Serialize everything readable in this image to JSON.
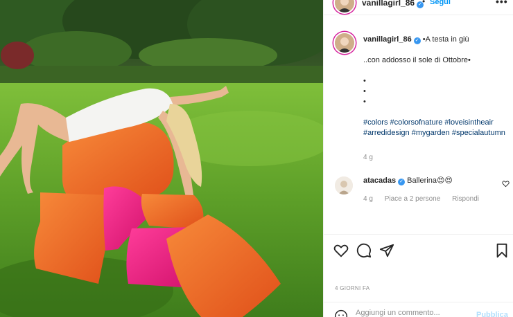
{
  "post": {
    "username": "vanillagirl_86",
    "verified_badge": "✓",
    "separator": "•",
    "follow_label": "Segui",
    "more_label": "•••"
  },
  "caption": {
    "username": "vanillagirl_86",
    "line1": "•A testa in giù",
    "line2": "..con addosso il sole di Ottobre•",
    "dots": [
      "•",
      "•",
      "•"
    ],
    "hashtags": [
      "#colors",
      "#colorsofnature",
      "#loveisintheair",
      "#arredidesign",
      "#mygarden",
      "#specialautumn"
    ],
    "time": "4 g"
  },
  "comment": {
    "username": "atacadas",
    "text": "Ballerina😍😍",
    "time": "4 g",
    "likes": "Piace a 2 persone",
    "reply": "Rispondi"
  },
  "actions": {
    "icons": [
      "heart-icon",
      "comment-icon",
      "share-icon",
      "bookmark-icon"
    ],
    "date": "4 GIORNI FA"
  },
  "add_comment": {
    "placeholder": "Aggiungi un commento...",
    "publish_label": "Pubblica"
  },
  "colors": {
    "link_blue": "#0095f6",
    "hashtag": "#00376b",
    "muted": "#8e8e8e",
    "verified": "#3897f0",
    "cushion_orange": "#f0641e",
    "cushion_pink": "#e8197a"
  }
}
